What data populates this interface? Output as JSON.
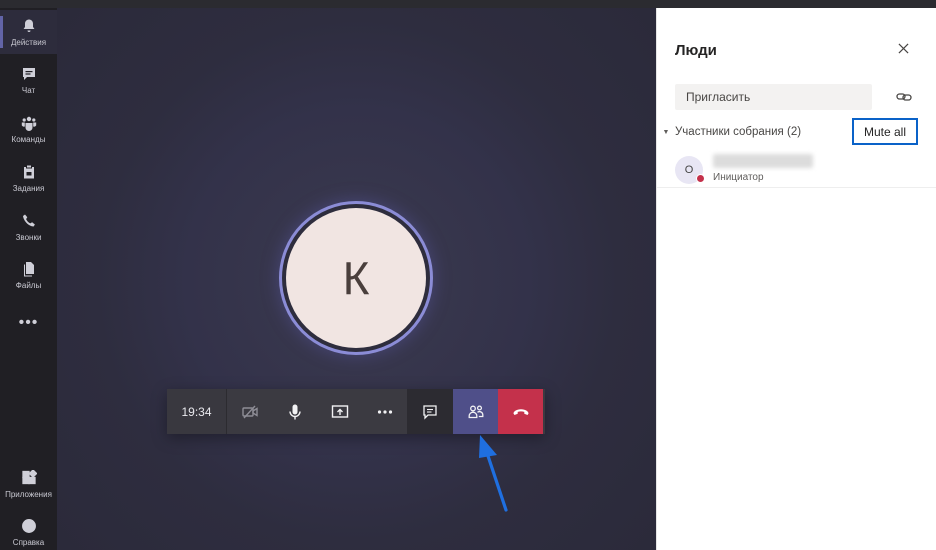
{
  "rail": {
    "items": [
      {
        "label": "Действия",
        "icon": "bell-icon",
        "active": true
      },
      {
        "label": "Чат",
        "icon": "chat-icon"
      },
      {
        "label": "Команды",
        "icon": "teams-icon"
      },
      {
        "label": "Задания",
        "icon": "assignments-icon"
      },
      {
        "label": "Звонки",
        "icon": "phone-icon"
      },
      {
        "label": "Файлы",
        "icon": "files-icon"
      }
    ],
    "more": "•••",
    "bottom_items": [
      {
        "label": "Приложения",
        "icon": "apps-icon"
      },
      {
        "label": "Справка",
        "icon": "help-icon"
      }
    ]
  },
  "stage": {
    "avatar_letter": "К",
    "callbar": {
      "timer": "19:34",
      "buttons": [
        "camera-off-icon",
        "microphone-icon",
        "share-screen-icon",
        "more-icon",
        "chat-icon",
        "people-icon",
        "hang-up-icon"
      ]
    }
  },
  "panel": {
    "title": "Люди",
    "invite_placeholder": "Пригласить",
    "section_label": "Участники собрания (2)",
    "mute_all": "Mute all",
    "participant": {
      "initial": "O",
      "role": "Инициатор"
    }
  },
  "colors": {
    "accent": "#6264a7",
    "hangup": "#c4314b",
    "highlight_border": "#0a62c8",
    "arrow": "#1f6fe0"
  }
}
